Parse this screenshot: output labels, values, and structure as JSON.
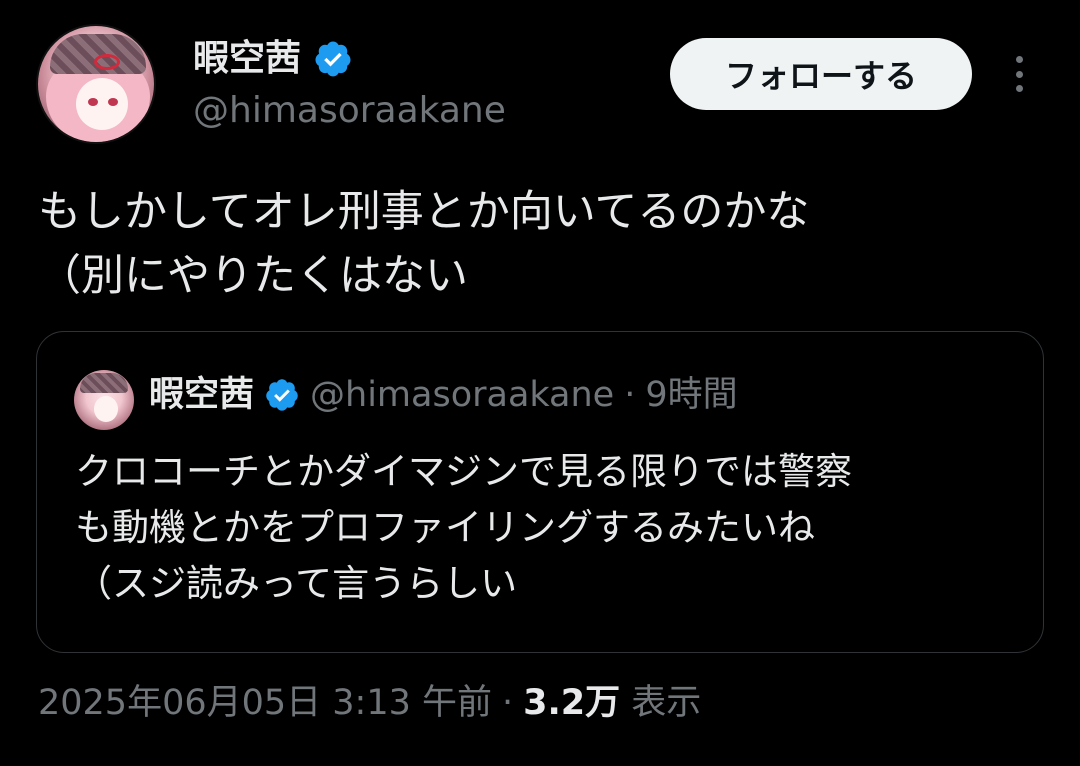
{
  "author": {
    "display_name": "暇空茜",
    "handle": "@himasoraakane",
    "verified": true
  },
  "actions": {
    "follow_label": "フォローする",
    "more_icon": "more-vertical-icon"
  },
  "tweet": {
    "lines": [
      "もしかしてオレ刑事とか向いてるのかな",
      "（別にやりたくはない"
    ]
  },
  "quote": {
    "display_name": "暇空茜",
    "handle": "@himasoraakane",
    "separator": "·",
    "time": "9時間",
    "lines": [
      "クロコーチとかダイマジンで見る限りでは警察",
      "も動機とかをプロファイリングするみたいね",
      "（スジ読みって言うらしい"
    ]
  },
  "footer": {
    "timestamp": "2025年06月05日 3:13 午前",
    "separator": "·",
    "views_count": "3.2万",
    "views_label": "表示"
  },
  "colors": {
    "background": "#000000",
    "text_primary": "#e7e9ea",
    "text_secondary": "#71767b",
    "verified_blue": "#1d9bf0",
    "border": "#2f3336",
    "follow_bg": "#eff3f4"
  }
}
